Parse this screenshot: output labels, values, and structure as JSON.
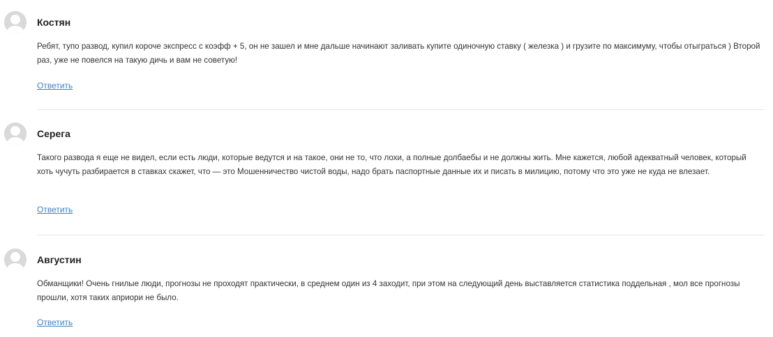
{
  "comments": [
    {
      "author": "Костян",
      "text": "Ребят, тупо развод, купил короче экспресс с коэфф + 5, он не зашел и мне дальше начинают заливать купите одиночную ставку ( железка ) и грузите по максимуму, чтобы отыграться ) Второй раз, уже не повелся на такую дичь и вам не советую!",
      "reply_label": "Ответить"
    },
    {
      "author": "Серега",
      "text": "Такого развода я еще не видел, если есть люди, которые ведутся и на такое, они не то, что лохи, а полные долбаебы и не должны жить. Мне кажется, любой адекватный человек, который хоть чучуть разбирается в ставках скажет, что — это Мошенничество чистой воды, надо брать паспортные данные их и писать в милицию, потому что это уже не куда не влезает.",
      "reply_label": "Ответить"
    },
    {
      "author": "Августин",
      "text": "Обманщики! Очень гнилые люди, прогнозы не проходят практически, в среднем один из 4 заходит, при этом на следующий день выставляется статистика поддельная , мол все прогнозы прошли, хотя таких априори не было.",
      "reply_label": "Ответить"
    }
  ],
  "icons": {
    "avatar": "user-avatar-icon"
  },
  "colors": {
    "link": "#3b82c4",
    "divider": "#e6e6e6",
    "avatar_bg": "#d9d9d9"
  }
}
